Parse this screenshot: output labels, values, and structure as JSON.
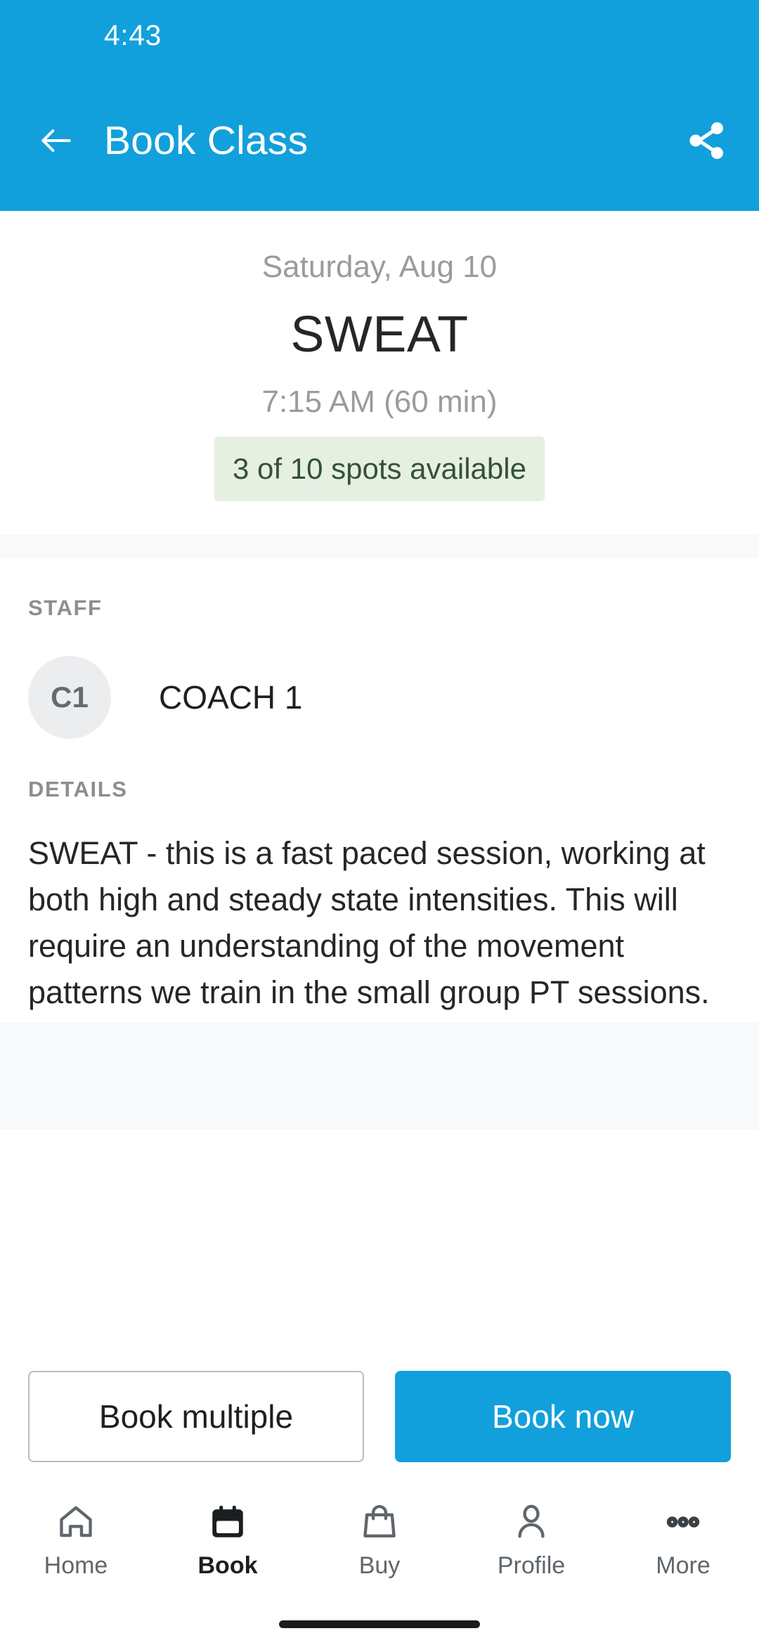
{
  "status_bar": {
    "time": "4:43"
  },
  "app_bar": {
    "title": "Book Class",
    "back_icon": "arrow-left-icon",
    "share_icon": "share-icon"
  },
  "class_summary": {
    "date": "Saturday, Aug 10",
    "name": "SWEAT",
    "time": "7:15 AM (60 min)",
    "spots_available": "3 of 10 spots available",
    "spots_badge_bg": "#e5f0e3",
    "spots_badge_color": "#35503a"
  },
  "staff_section": {
    "label": "STAFF",
    "members": [
      {
        "initials": "C1",
        "name": "COACH 1"
      }
    ]
  },
  "details_section": {
    "label": "DETAILS",
    "text": "SWEAT - this is a fast paced session, working at both high and steady state intensities. This will require an understanding of the movement patterns we train in the small group PT sessions."
  },
  "actions": {
    "secondary_label": "Book multiple",
    "primary_label": "Book now"
  },
  "bottom_nav": {
    "items": [
      {
        "label": "Home",
        "icon": "home-icon",
        "active": false
      },
      {
        "label": "Book",
        "icon": "calendar-icon",
        "active": true
      },
      {
        "label": "Buy",
        "icon": "shopping-bag-icon",
        "active": false
      },
      {
        "label": "Profile",
        "icon": "person-icon",
        "active": false
      },
      {
        "label": "More",
        "icon": "more-dots-icon",
        "active": false
      }
    ]
  },
  "theme": {
    "brand_blue": "#11a0dc",
    "band_gray": "#f7f9fb",
    "avatar_gray": "#ebedef"
  }
}
